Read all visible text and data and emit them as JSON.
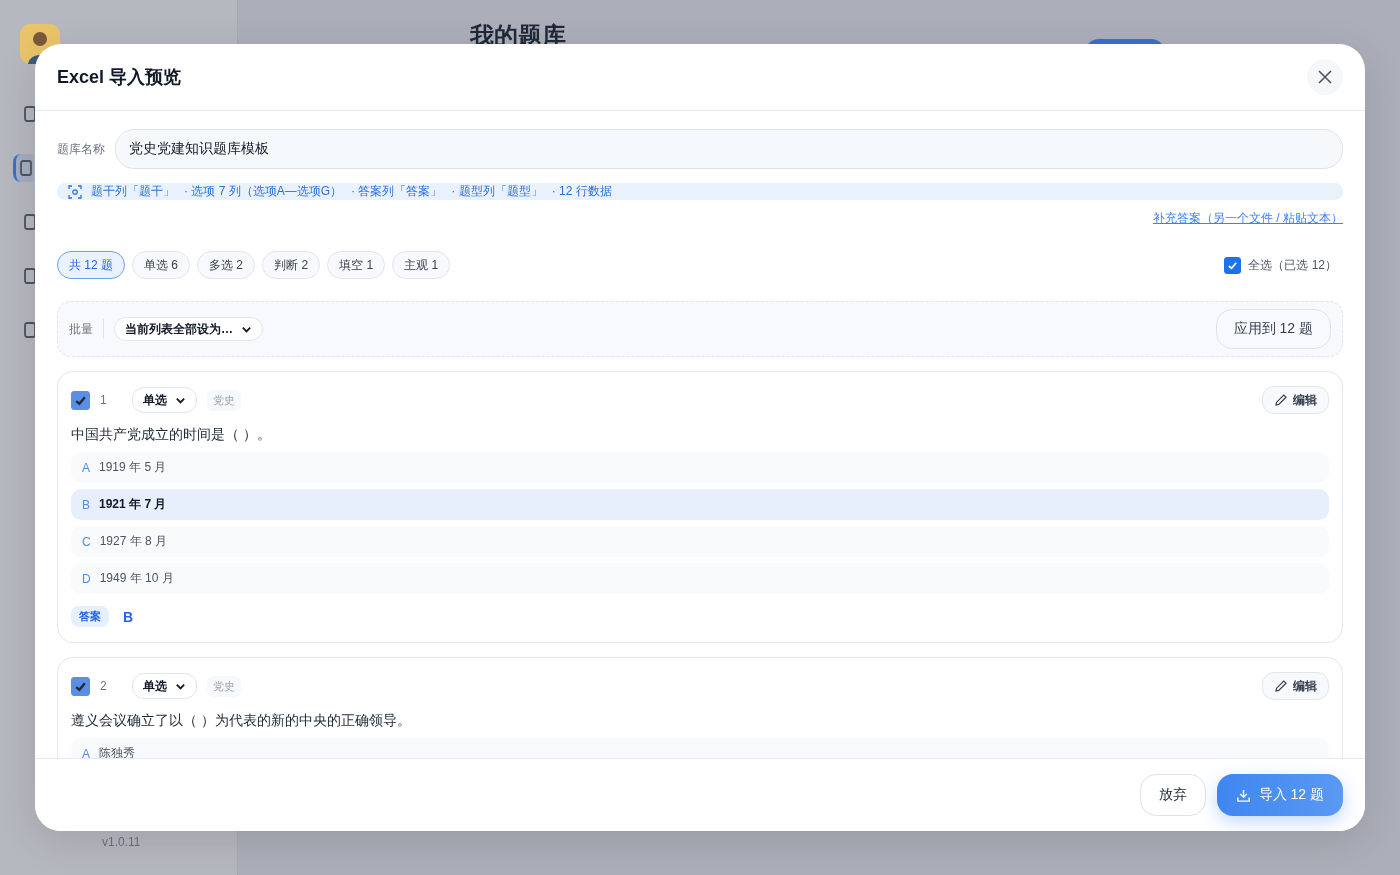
{
  "background": {
    "page_title": "我的题库",
    "version": "v1.0.11",
    "nav": [
      {
        "selected": false
      },
      {
        "selected": true
      },
      {
        "selected": false
      },
      {
        "selected": false
      },
      {
        "selected": false
      }
    ]
  },
  "dialog": {
    "title": "Excel 导入预览",
    "name_label": "题库名称",
    "name_value": "党史党建知识题库模板",
    "mapping": [
      "题干列「题干」",
      "· 选项 7 列（选项A—选项G）",
      "· 答案列「答案」",
      "· 题型列「题型」",
      "· 12 行数据"
    ],
    "supplement_link": "补充答案（另一个文件 / 粘贴文本）",
    "filters": [
      {
        "label": "共 12 题",
        "selected": true
      },
      {
        "label": "单选 6",
        "selected": false
      },
      {
        "label": "多选 2",
        "selected": false
      },
      {
        "label": "判断 2",
        "selected": false
      },
      {
        "label": "填空 1",
        "selected": false
      },
      {
        "label": "主观 1",
        "selected": false
      }
    ],
    "select_all": {
      "label": "全选（已选 12）",
      "checked": true
    },
    "batch": {
      "label": "批量",
      "select_value": "当前列表全部设为…",
      "apply_button": "应用到 12 题"
    },
    "questions": [
      {
        "number": "1",
        "checked": true,
        "type": "单选",
        "tag": "党史",
        "edit_button": "编辑",
        "stem": "中国共产党成立的时间是（ ）。",
        "options": [
          {
            "letter": "A",
            "text": "1919 年 5 月",
            "selected": false
          },
          {
            "letter": "B",
            "text": "1921 年 7 月",
            "selected": true
          },
          {
            "letter": "C",
            "text": "1927 年 8 月",
            "selected": false
          },
          {
            "letter": "D",
            "text": "1949 年 10 月",
            "selected": false
          }
        ],
        "answer_label": "答案",
        "answer": "B"
      },
      {
        "number": "2",
        "checked": true,
        "type": "单选",
        "tag": "党史",
        "edit_button": "编辑",
        "stem": "遵义会议确立了以（ ）为代表的新的中央的正确领导。",
        "options": [
          {
            "letter": "A",
            "text": "陈独秀",
            "selected": false
          }
        ]
      }
    ],
    "cancel_button": "放弃",
    "import_button": "导入 12 题"
  }
}
